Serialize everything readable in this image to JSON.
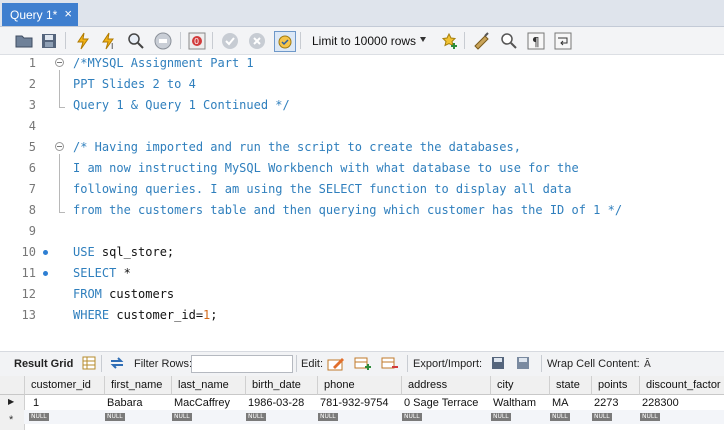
{
  "tab": {
    "title": "Query 1*",
    "close": "×"
  },
  "toolbar": {
    "limit_label": "Limit to 10000 rows"
  },
  "editor": {
    "lines": [
      {
        "n": "1",
        "text": "/*MYSQL Assignment Part 1"
      },
      {
        "n": "2",
        "text": "PPT Slides 2 to 4"
      },
      {
        "n": "3",
        "text": "Query 1 & Query 1 Continued */"
      },
      {
        "n": "4",
        "text": ""
      },
      {
        "n": "5",
        "text": "/* Having imported and run the script to create the databases,"
      },
      {
        "n": "6",
        "text": "I am now instructing MySQL Workbench with what database to use for the"
      },
      {
        "n": "7",
        "text": "following queries. I am using the SELECT function to display all data"
      },
      {
        "n": "8",
        "text": "from the customers table and then querying which customer has the ID of 1 */"
      },
      {
        "n": "9",
        "text": ""
      },
      {
        "n": "10",
        "kw": "USE",
        "rest": " sql_store;"
      },
      {
        "n": "11",
        "kw": "SELECT",
        "rest": " *"
      },
      {
        "n": "12",
        "kw": "FROM",
        "rest": " customers"
      },
      {
        "n": "13",
        "kw": "WHERE",
        "rest": " customer_id=",
        "num": "1",
        "end": ";"
      }
    ]
  },
  "results": {
    "result_grid": "Result Grid",
    "filter_rows": "Filter Rows:",
    "edit": "Edit:",
    "export_import": "Export/Import:",
    "wrap_cell": "Wrap Cell Content:",
    "columns": [
      "customer_id",
      "first_name",
      "last_name",
      "birth_date",
      "phone",
      "address",
      "city",
      "state",
      "points",
      "discount_factor"
    ],
    "row": [
      "1",
      "Babara",
      "MacCaffrey",
      "1986-03-28",
      "781-932-9754",
      "0 Sage Terrace",
      "Waltham",
      "MA",
      "2273",
      "228300"
    ],
    "null_label": "NULL",
    "row_marker": "▶",
    "new_marker": "*"
  }
}
